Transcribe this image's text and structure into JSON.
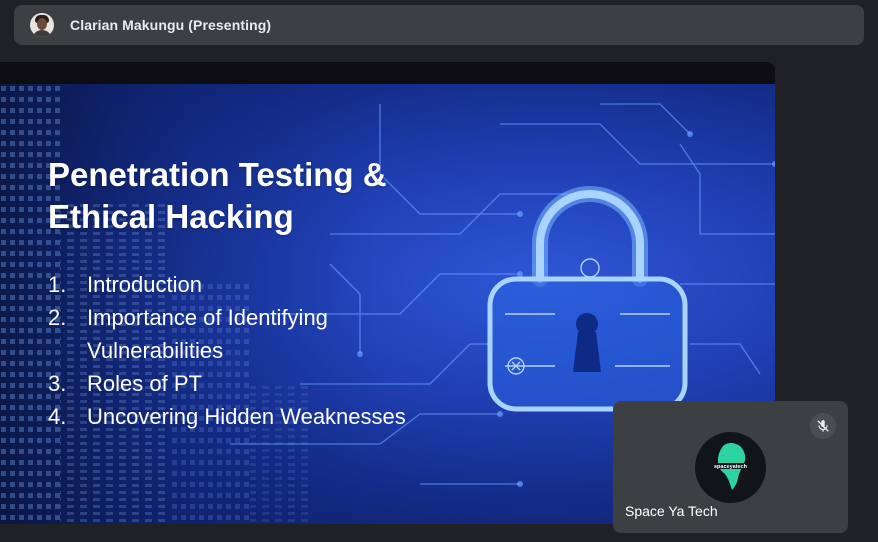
{
  "presenter": {
    "name": "Clarian Makungu (Presenting)",
    "avatar_icon": "person-avatar"
  },
  "slide": {
    "title_line1": "Penetration Testing &",
    "title_line2": "Ethical Hacking",
    "agenda": [
      {
        "num": "1.",
        "text": "Introduction"
      },
      {
        "num": "2.",
        "text": "Importance of Identifying"
      },
      {
        "num": "",
        "text": "Vulnerabilities"
      },
      {
        "num": "3.",
        "text": "Roles of PT"
      },
      {
        "num": "4.",
        "text": "Uncovering Hidden Weaknesses"
      }
    ],
    "background_icon": "padlock-circuit-icon"
  },
  "participant": {
    "name": "Space Ya Tech",
    "logo_text": "spaceyatech",
    "mic_icon": "mic-off-icon"
  },
  "colors": {
    "app_background": "#202124",
    "tile_background": "#3c4043",
    "slide_blue": "#1f3fb2",
    "logo_green": "#2bd4a0"
  }
}
